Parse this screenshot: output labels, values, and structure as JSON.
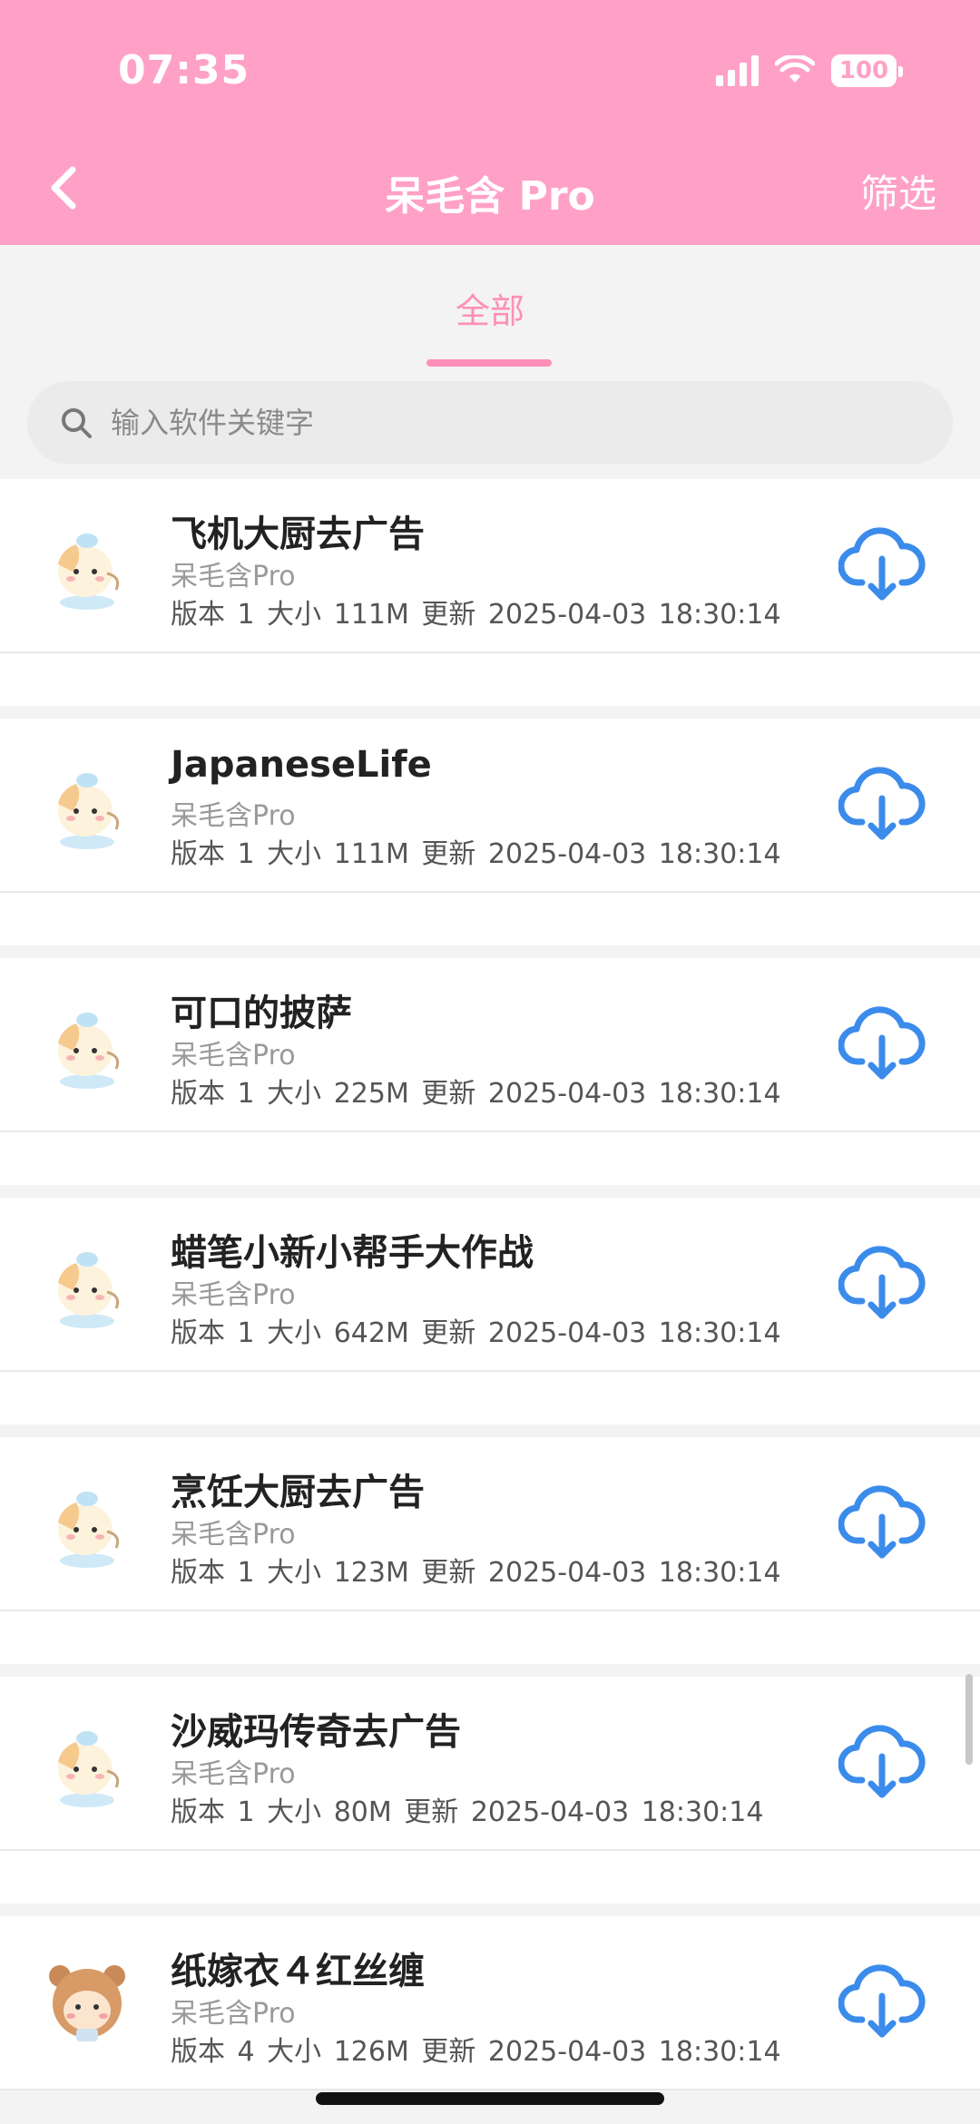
{
  "status_bar": {
    "time": "07:35",
    "battery": "100"
  },
  "nav": {
    "title": "呆毛含 Pro",
    "filter_label": "筛选"
  },
  "tabs": [
    {
      "label": "全部",
      "active": true
    }
  ],
  "search": {
    "placeholder": "输入软件关键字"
  },
  "colors": {
    "header": "#ffa1c6",
    "accent": "#ff8fb8",
    "download": "#3b8beb"
  },
  "apps": [
    {
      "name": "飞机大厨去广告",
      "developer": "呆毛含Pro",
      "meta": "版本 1  大小 111M  更新 2025-04-03 18:30:14",
      "icon": "chick-sticker-icon"
    },
    {
      "name": "JapaneseLife",
      "developer": "呆毛含Pro",
      "meta": "版本 1  大小 111M  更新 2025-04-03 18:30:14",
      "icon": "chick-sticker-icon"
    },
    {
      "name": "可口的披萨",
      "developer": "呆毛含Pro",
      "meta": "版本 1  大小 225M  更新 2025-04-03 18:30:14",
      "icon": "chick-sticker-icon"
    },
    {
      "name": "蜡笔小新小帮手大作战",
      "developer": "呆毛含Pro",
      "meta": "版本 1  大小 642M  更新 2025-04-03 18:30:14",
      "icon": "chick-sticker-icon"
    },
    {
      "name": "烹饪大厨去广告",
      "developer": "呆毛含Pro",
      "meta": "版本 1  大小 123M  更新 2025-04-03 18:30:14",
      "icon": "chick-sticker-icon"
    },
    {
      "name": "沙威玛传奇去广告",
      "developer": "呆毛含Pro",
      "meta": "版本 1  大小 80M  更新 2025-04-03 18:30:14",
      "icon": "chick-sticker-icon"
    },
    {
      "name": "纸嫁衣４红丝缠",
      "developer": "呆毛含Pro",
      "meta": "版本 4  大小 126M  更新 2025-04-03 18:30:14",
      "icon": "bear-sticker-icon"
    }
  ]
}
